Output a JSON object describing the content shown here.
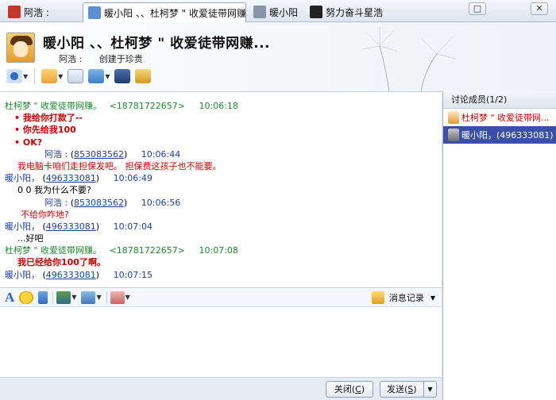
{
  "tabs": [
    {
      "label": "阿浩 :"
    },
    {
      "label": "暖小阳 、、杜柯梦 \" 收爱徒带网赚..."
    },
    {
      "label": "暖小阳"
    },
    {
      "label": "努力奋斗星浩"
    }
  ],
  "window_controls": {
    "restore": "□",
    "close": "✕"
  },
  "header": {
    "title": "暖小阳 、、杜柯梦 \" 收爱徒带网赚...",
    "creator_name": "阿浩 :",
    "creator_label": "创建于珍贵"
  },
  "toolbar_icons": [
    "profile-icon",
    "folder-share-icon",
    "email-icon",
    "add-member-icon",
    "user-settings-icon",
    "app-icon"
  ],
  "messages": [
    {
      "sender": "杜柯梦 \" 收爱徒带网赚。",
      "id": "<18781722657>",
      "time": "10:06:18"
    },
    {
      "text": "• 我给你打款了--"
    },
    {
      "text": "• 你先给我100"
    },
    {
      "text": "• OK?"
    },
    {
      "sender": "阿浩 :",
      "id": "853083562",
      "time": "10:06:44"
    },
    {
      "text": "我电脑卡咱们走担保发吧。  担保费这孩子也不能要。"
    },
    {
      "sender": "暖小阳，",
      "id": "496333081",
      "time": "10:06:49"
    },
    {
      "text": "0 0 我为什么不要?"
    },
    {
      "sender": "阿浩 :",
      "id": "853083562",
      "time": "10:06:56"
    },
    {
      "text": "不给你咋地?"
    },
    {
      "sender": "暖小阳，",
      "id": "496333081",
      "time": "10:07:04"
    },
    {
      "text": "...好吧"
    },
    {
      "sender": "杜柯梦 \" 收爱徒带网赚。",
      "id": "<18781722657>",
      "time": "10:07:08"
    },
    {
      "text": "我已经给你100了啊。"
    },
    {
      "sender": "暖小阳，",
      "id": "496333081",
      "time": "10:07:15"
    }
  ],
  "input_toolbar": {
    "history_label": "消息记录"
  },
  "footer": {
    "close_label": "关闭(",
    "close_key": "C",
    "send_label": "发送(",
    "send_key": "S",
    "paren": ")"
  },
  "members_panel": {
    "title": "讨论成员(1/2)",
    "members": [
      {
        "name": "杜柯梦 \" 收爱徒带网..."
      },
      {
        "name": "暖小阳，(496333081)"
      }
    ]
  },
  "colors": {
    "accent_green": "#1c8a2f",
    "link_blue": "#1c3fa8",
    "alert_red": "#d40000",
    "selection": "#3a4fa8"
  }
}
